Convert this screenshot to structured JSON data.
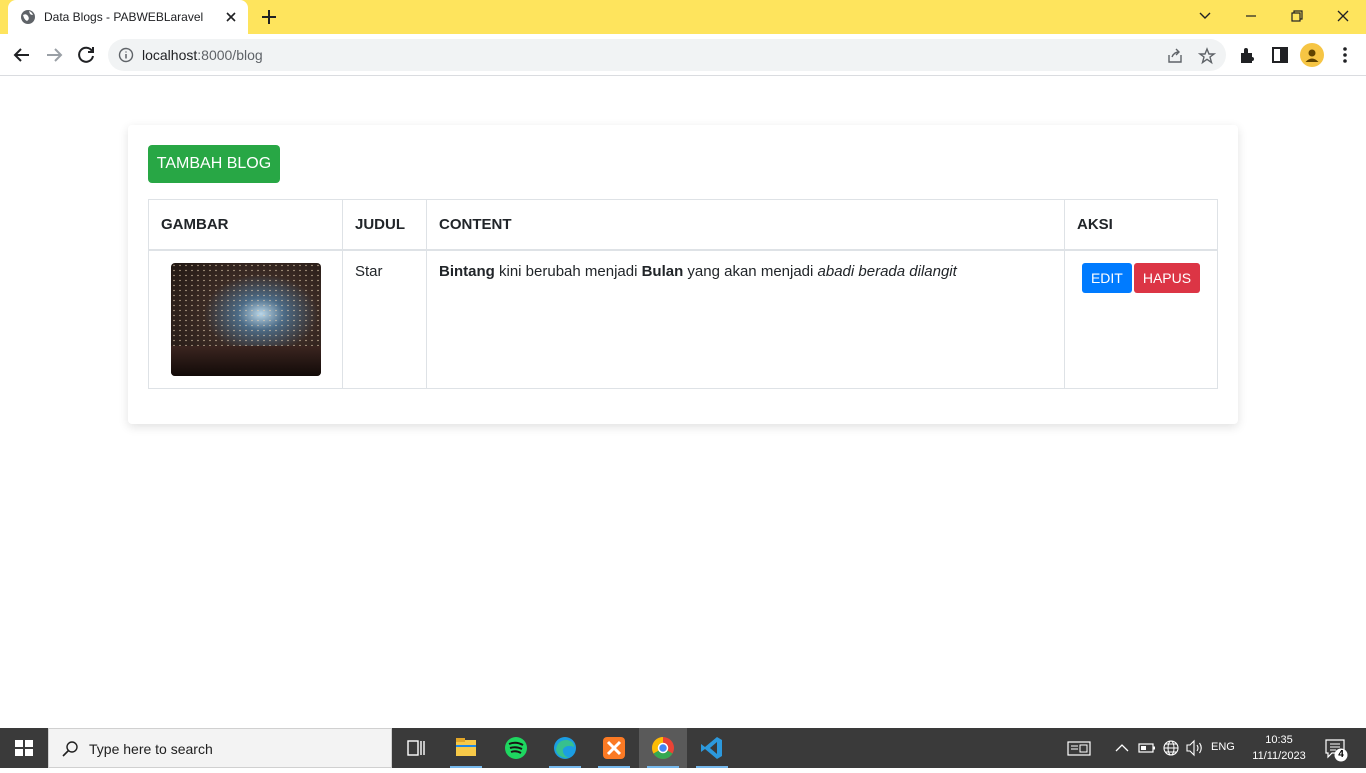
{
  "browser": {
    "tab_title": "Data Blogs - PABWEBLaravel",
    "url_host": "localhost",
    "url_path": ":8000/blog"
  },
  "page": {
    "add_button_label": "TAMBAH BLOG",
    "table": {
      "headers": [
        "GAMBAR",
        "JUDUL",
        "CONTENT",
        "AKSI"
      ],
      "rows": [
        {
          "judul": "Star",
          "content_bold_1": "Bintang",
          "content_text_1": " kini berubah menjadi ",
          "content_bold_2": "Bulan",
          "content_text_2": " yang akan menjadi ",
          "content_italic": "abadi berada dilangit",
          "edit_label": "EDIT",
          "hapus_label": "HAPUS"
        }
      ]
    }
  },
  "taskbar": {
    "search_placeholder": "Type here to search",
    "language": "ENG",
    "time": "10:35",
    "date": "11/11/2023",
    "notification_count": "4"
  },
  "colors": {
    "tabbar": "#fee45d",
    "success": "#28a745",
    "primary": "#007bff",
    "danger": "#dc3545"
  }
}
